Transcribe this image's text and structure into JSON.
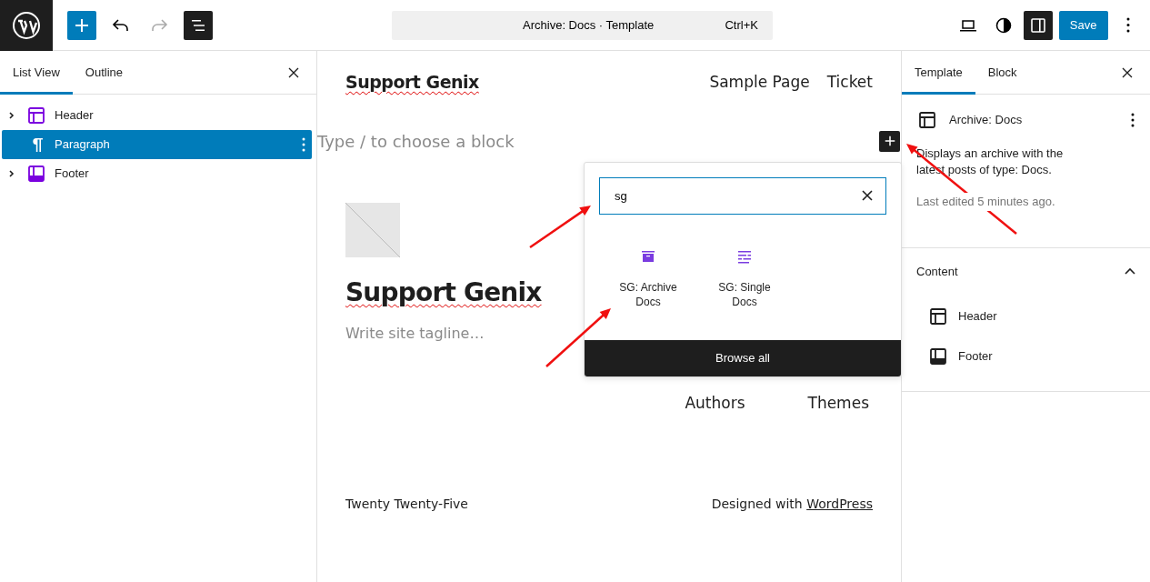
{
  "toolbar": {
    "tools": [
      {
        "kind": "add",
        "active": true,
        "disabled": false
      },
      {
        "kind": "undo",
        "active": false,
        "disabled": false
      },
      {
        "kind": "redo",
        "active": false,
        "disabled": true
      },
      {
        "kind": "overview",
        "active": true,
        "disabled": false
      }
    ],
    "command": {
      "title": "Archive: Docs · Template",
      "shortcut": "Ctrl+K"
    },
    "actions": [
      {
        "kind": "preview",
        "active": false
      },
      {
        "kind": "styles",
        "active": false
      },
      {
        "kind": "settings",
        "active": true
      }
    ],
    "save": "Save"
  },
  "list_panel": {
    "tabs": [
      {
        "label": "List View",
        "selected": true
      },
      {
        "label": "Outline",
        "selected": false
      }
    ],
    "items": [
      {
        "label": "Header",
        "kind": "header",
        "selected": false,
        "expandable": true
      },
      {
        "label": "Paragraph",
        "kind": "paragraph",
        "selected": true,
        "expandable": false
      },
      {
        "label": "Footer",
        "kind": "footer",
        "selected": false,
        "expandable": true
      }
    ]
  },
  "canvas": {
    "site_title": "Support Genix",
    "nav": [
      "Sample Page",
      "Ticket"
    ],
    "block_placeholder": "Type / to choose a block",
    "big_title": "Support Genix",
    "tagline_placeholder": "Write site tagline…",
    "nav_lower": [
      "Authors",
      "Themes"
    ],
    "footer_left": "Twenty Twenty-Five",
    "footer_credit": "Designed with",
    "footer_link": "WordPress"
  },
  "inserter": {
    "search": "sg",
    "results": [
      {
        "label": "SG: Archive Docs",
        "kind": "archive"
      },
      {
        "label": "SG: Single Docs",
        "kind": "single"
      }
    ],
    "browse": "Browse all"
  },
  "settings_panel": {
    "tabs": [
      {
        "label": "Template",
        "selected": true
      },
      {
        "label": "Block",
        "selected": false
      }
    ],
    "template_name": "Archive: Docs",
    "description": "Displays an archive with the latest posts of type: Docs.",
    "last_edited": "Last edited 5 minutes ago.",
    "content": {
      "title": "Content",
      "expanded": true,
      "items": [
        {
          "label": "Header",
          "kind": "header"
        },
        {
          "label": "Footer",
          "kind": "footer"
        }
      ]
    }
  }
}
